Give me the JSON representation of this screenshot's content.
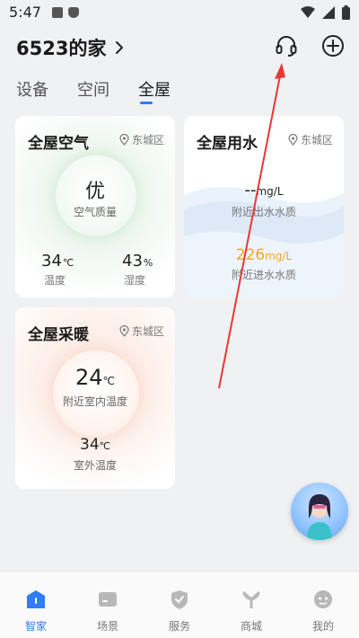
{
  "status_bar": {
    "time": "5:47"
  },
  "header": {
    "home_name": "6523的家"
  },
  "tabs": [
    {
      "label": "设备"
    },
    {
      "label": "空间"
    },
    {
      "label": "全屋"
    }
  ],
  "air_card": {
    "title": "全屋空气",
    "location": "东城区",
    "grade": "优",
    "grade_label": "空气质量",
    "temp_value": "34",
    "temp_unit": "℃",
    "temp_label": "温度",
    "humidity_value": "43",
    "humidity_unit": "%",
    "humidity_label": "湿度"
  },
  "water_card": {
    "title": "全屋用水",
    "location": "东城区",
    "outlet_value": "--",
    "outlet_unit": "mg/L",
    "outlet_label": "附近出水水质",
    "inlet_value": "226",
    "inlet_unit": "mg/L",
    "inlet_label": "附近进水水质",
    "inlet_color": "#f5a623"
  },
  "heat_card": {
    "title": "全屋采暖",
    "location": "东城区",
    "indoor_value": "24",
    "indoor_unit": "℃",
    "indoor_label": "附近室内温度",
    "outdoor_value": "34",
    "outdoor_unit": "℃",
    "outdoor_label": "室外温度"
  },
  "bottom_nav": [
    {
      "label": "智家",
      "icon": "home-icon"
    },
    {
      "label": "场景",
      "icon": "scene-icon"
    },
    {
      "label": "服务",
      "icon": "service-icon"
    },
    {
      "label": "商城",
      "icon": "mall-icon"
    },
    {
      "label": "我的",
      "icon": "profile-icon"
    }
  ],
  "colors": {
    "accent": "#2f7cf6",
    "annotation_arrow": "#e53935"
  }
}
